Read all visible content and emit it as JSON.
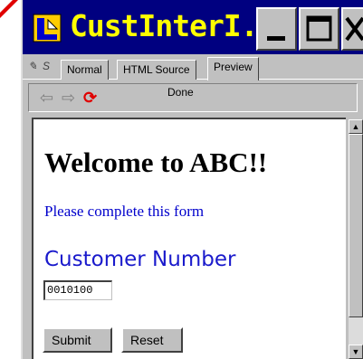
{
  "window": {
    "title": "CustInterI...",
    "title_color": "#ffff00",
    "titlebar_color": "#000080"
  },
  "caption_buttons": [
    {
      "name": "minimize",
      "glyph": "_"
    },
    {
      "name": "maximize",
      "glyph": "□"
    },
    {
      "name": "close",
      "glyph": "X"
    }
  ],
  "tabstrip": {
    "tabs": [
      "Normal",
      "HTML Source",
      "Preview"
    ],
    "active": "Preview"
  },
  "toolbar": {
    "back_icon": "back-arrow-icon",
    "forward_icon": "forward-arrow-icon",
    "refresh_icon": "refresh-icon",
    "status": "Done"
  },
  "page": {
    "heading": "Welcome to ABC!!",
    "lead": "Please complete this form",
    "field_label": "Customer Number",
    "field_value": "0010100",
    "submit_label": "Submit",
    "reset_label": "Reset",
    "link_color": "#0000cc"
  }
}
